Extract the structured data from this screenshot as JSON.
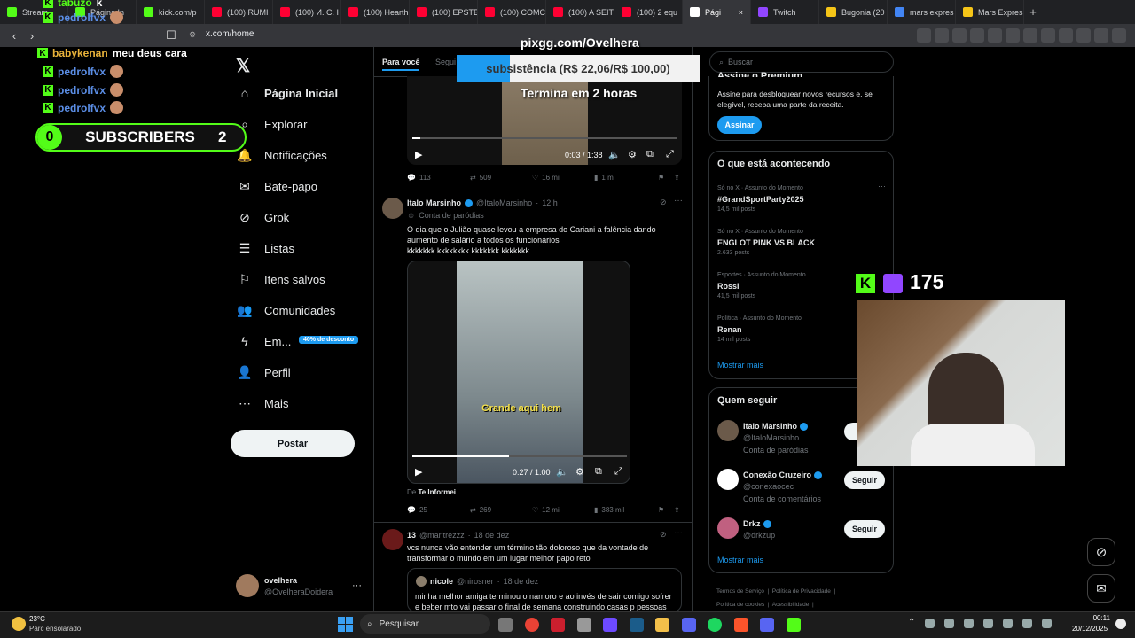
{
  "browser": {
    "tabs": [
      {
        "label": "Stream",
        "icon": "kick-icon",
        "color": "#53fc18"
      },
      {
        "label": "Página In",
        "icon": "kick-icon",
        "color": "#53fc18"
      },
      {
        "label": "kick.com/p",
        "icon": "kick-icon",
        "color": "#53fc18"
      },
      {
        "label": "(100) RUMI",
        "icon": "youtube-icon",
        "color": "#ff0033"
      },
      {
        "label": "(100) И. С. I",
        "icon": "youtube-icon",
        "color": "#ff0033"
      },
      {
        "label": "(100) Hearth",
        "icon": "youtube-icon",
        "color": "#ff0033"
      },
      {
        "label": "(100) EPSTE",
        "icon": "youtube-icon",
        "color": "#ff0033"
      },
      {
        "label": "(100) COMC",
        "icon": "youtube-icon",
        "color": "#ff0033"
      },
      {
        "label": "(100) A SEIT",
        "icon": "youtube-icon",
        "color": "#ff0033"
      },
      {
        "label": "(100) 2 equ",
        "icon": "youtube-icon",
        "color": "#ff0033"
      },
      {
        "label": "Pági",
        "icon": "x-icon",
        "color": "#ffffff",
        "active": true
      },
      {
        "label": "Twitch",
        "icon": "twitch-icon",
        "color": "#9146ff"
      },
      {
        "label": "Bugonia (20",
        "icon": "imdb-icon",
        "color": "#f5c518"
      },
      {
        "label": "mars expres",
        "icon": "google-icon",
        "color": "#4285f4"
      },
      {
        "label": "Mars Expres",
        "icon": "imdb-icon",
        "color": "#f5c518"
      }
    ],
    "new_tab": "+",
    "url": "x.com/home"
  },
  "overlay": {
    "chat": [
      {
        "user": "tabuzo",
        "message": "k",
        "color": "#53fc18"
      },
      {
        "user": "pedrolfvx",
        "message": "",
        "color": "#5b8ee6"
      },
      {
        "user": "babykenan",
        "message": "meu deus cara",
        "color": "#e8b23a"
      },
      {
        "user": "pedrolfvx",
        "message": "",
        "color": "#5b8ee6"
      },
      {
        "user": "pedrolfvx",
        "message": "",
        "color": "#5b8ee6"
      },
      {
        "user": "pedrolfvx",
        "message": "",
        "color": "#5b8ee6"
      }
    ],
    "subscribers": {
      "left": "0",
      "title": "SUBSCRIBERS",
      "right": "2"
    },
    "pix_url": "pixgg.com/Ovelhera",
    "goal_text": "subsistência (R$ 22,06/R$ 100,00)",
    "goal_progress": 0.22,
    "timer": "Termina em 2 horas",
    "viewer_count": "175"
  },
  "x_nav": {
    "items": [
      {
        "label": "Página Inicial",
        "icon": "home-icon",
        "bold": true
      },
      {
        "label": "Explorar",
        "icon": "search-icon"
      },
      {
        "label": "Notificações",
        "icon": "bell-icon"
      },
      {
        "label": "Bate-papo",
        "icon": "mail-icon"
      },
      {
        "label": "Grok",
        "icon": "grok-icon"
      },
      {
        "label": "Listas",
        "icon": "list-icon"
      },
      {
        "label": "Itens salvos",
        "icon": "bookmark-icon"
      },
      {
        "label": "Comunidades",
        "icon": "people-icon"
      },
      {
        "label": "Em...",
        "icon": "lightning-icon"
      },
      {
        "label": "Perfil",
        "icon": "person-icon"
      },
      {
        "label": "Mais",
        "icon": "more-icon"
      }
    ],
    "discount_badge": "40% de desconto",
    "post_button": "Postar",
    "account": {
      "name": "ovelhera",
      "handle": "@OvelheraDoidera"
    }
  },
  "feed": {
    "tabs": [
      "Para você",
      "Segui"
    ],
    "tweet0": {
      "video_time": "0:03 / 1:38",
      "progress": 0.03,
      "stats": {
        "replies": "113",
        "retweets": "509",
        "likes": "16 mil",
        "views": "1 mi"
      }
    },
    "tweet1": {
      "name": "Italo Marsinho",
      "handle": "@ItaloMarsinho",
      "time": "12 h",
      "label": "Conta de paródias",
      "text": "O dia que o Julião quase levou a empresa do Cariani a falência dando aumento de salário a todos os funcionários\nkkkkkkk kkkkkkkk kkkkkkk kkkkkkk",
      "caption": "Grande aqui hem",
      "video_time": "0:27 / 1:00",
      "progress": 0.45,
      "source_prefix": "De",
      "source": "Te Informei",
      "stats": {
        "replies": "25",
        "retweets": "269",
        "likes": "12 mil",
        "views": "383 mil"
      }
    },
    "tweet2": {
      "name": "13",
      "handle": "@maritrezzz",
      "time": "18 de dez",
      "text": "vcs nunca vão entender um término tão doloroso que da vontade de transformar o mundo em um lugar melhor papo reto",
      "quote": {
        "name": "nicole",
        "handle": "@nirosner",
        "time": "18 de dez",
        "text": "minha melhor amiga terminou o namoro e ao invés de sair comigo sofrer e beber mto vai passar o final de semana construindo casas p pessoas em"
      }
    }
  },
  "sidebar": {
    "search_placeholder": "Buscar",
    "premium": {
      "title": "Assine o Premium",
      "text": "Assine para desbloquear novos recursos e, se elegível, receba uma parte da receita.",
      "button": "Assinar"
    },
    "trends_title": "O que está acontecendo",
    "trends": [
      {
        "category": "Só no X · Assunto do Momento",
        "name": "#GrandSportParty2025",
        "posts": "14,5 mil posts"
      },
      {
        "category": "Só no X · Assunto do Momento",
        "name": "ENGLOT PINK VS BLACK",
        "posts": "2.633 posts"
      },
      {
        "category": "Esportes · Assunto do Momento",
        "name": "Rossi",
        "posts": "41,5 mil posts"
      },
      {
        "category": "Política · Assunto do Momento",
        "name": "Renan",
        "posts": "14 mil posts"
      }
    ],
    "show_more": "Mostrar mais",
    "who_title": "Quem seguir",
    "who": [
      {
        "name": "Italo Marsinho",
        "handle": "@ItaloMarsinho",
        "note": "Conta de paródias",
        "button": "S",
        "color": "#6b5a4a"
      },
      {
        "name": "Conexão Cruzeiro",
        "handle": "@conexaocec",
        "note": "Conta de comentários",
        "button": "Seguir",
        "color": "#ffffff"
      },
      {
        "name": "Drkz",
        "handle": "@drkzup",
        "note": "",
        "button": "Seguir",
        "color": "#c06080"
      }
    ],
    "who_more": "Mostrar mais",
    "footer": [
      "Termos de Serviço",
      "Política de Privacidade",
      "Política de cookies",
      "Acessibilidade"
    ]
  },
  "taskbar": {
    "weather_temp": "23°C",
    "weather_desc": "Parc ensolarado",
    "search_label": "Pesquisar",
    "time": "00:11",
    "date": "20/12/2025"
  }
}
